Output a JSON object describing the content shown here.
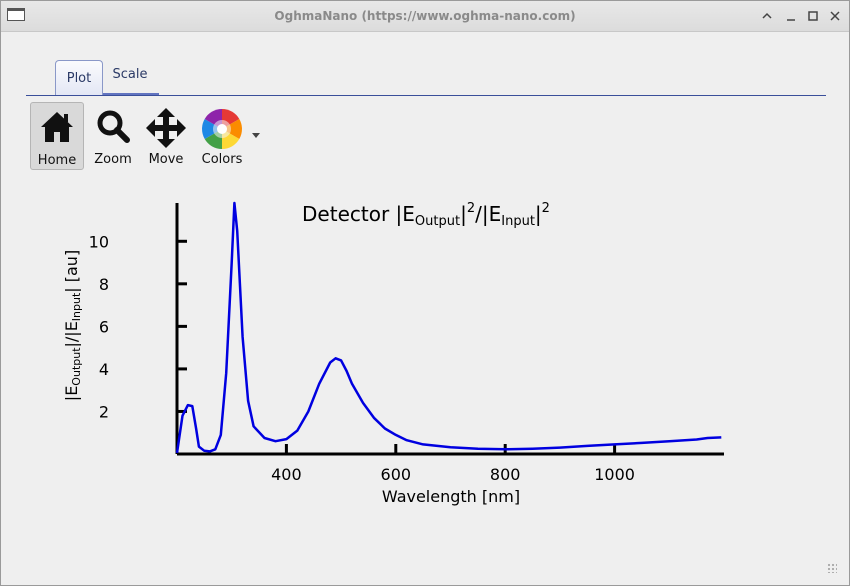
{
  "window": {
    "title": "OghmaNano (https://www.oghma-nano.com)"
  },
  "tabs": [
    {
      "label": "Plot"
    },
    {
      "label": "Scale"
    }
  ],
  "toolbar": [
    {
      "label": "Home"
    },
    {
      "label": "Zoom"
    },
    {
      "label": "Move"
    },
    {
      "label": "Colors"
    }
  ],
  "chart_data": {
    "type": "line",
    "title": "Detector |E_Output|^2/|E_Input|^2",
    "xlabel": "Wavelength [nm]",
    "ylabel": "|E_Output|/|E_Input| [au]",
    "xlim": [
      200,
      1200
    ],
    "ylim": [
      0,
      11.8
    ],
    "xticks": [
      400,
      600,
      800,
      1000
    ],
    "yticks": [
      2,
      4,
      6,
      8,
      10
    ],
    "grid": false,
    "series": [
      {
        "color": "#0000e0",
        "x": [
          200,
          210,
          220,
          228,
          235,
          240,
          250,
          260,
          270,
          280,
          290,
          300,
          305,
          310,
          315,
          320,
          330,
          340,
          360,
          380,
          400,
          420,
          440,
          460,
          480,
          490,
          500,
          510,
          520,
          540,
          560,
          580,
          600,
          620,
          650,
          700,
          750,
          800,
          850,
          900,
          950,
          1000,
          1050,
          1100,
          1150,
          1170,
          1195
        ],
        "y": [
          0.05,
          1.8,
          2.3,
          2.25,
          1.2,
          0.35,
          0.15,
          0.12,
          0.22,
          0.9,
          3.8,
          9.0,
          11.8,
          10.5,
          8.0,
          5.5,
          2.5,
          1.3,
          0.75,
          0.6,
          0.7,
          1.1,
          2.0,
          3.3,
          4.3,
          4.5,
          4.4,
          3.9,
          3.3,
          2.4,
          1.7,
          1.2,
          0.9,
          0.65,
          0.45,
          0.32,
          0.25,
          0.22,
          0.25,
          0.3,
          0.38,
          0.45,
          0.52,
          0.6,
          0.68,
          0.75,
          0.78
        ]
      }
    ]
  }
}
